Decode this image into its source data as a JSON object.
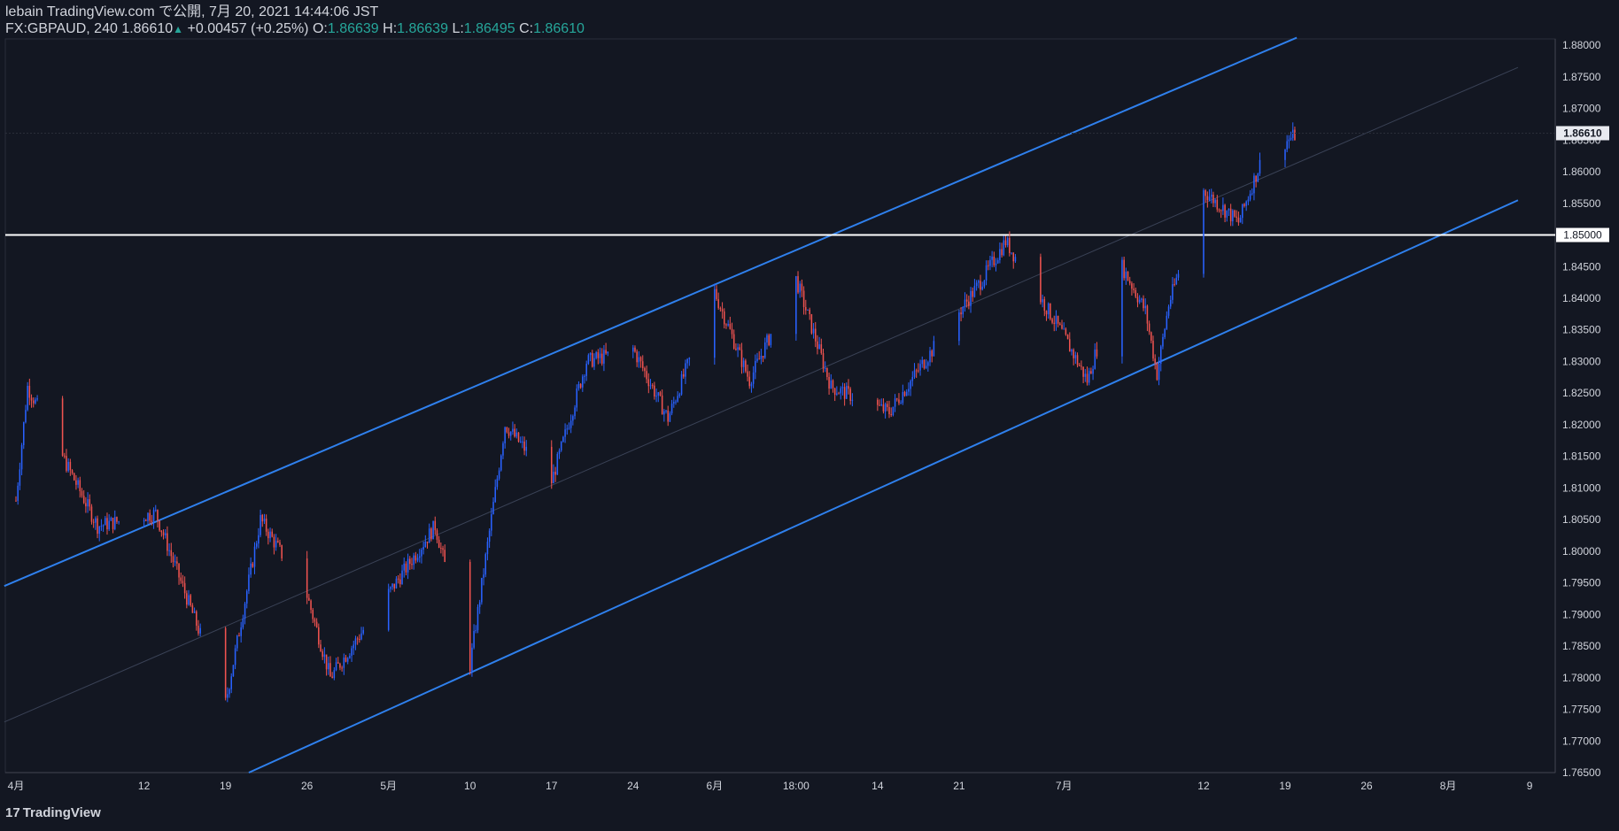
{
  "header": {
    "publish_line": "lebain TradingView.com で公開, 7月 20, 2021 14:44:06 JST",
    "symbol": "FX:GBPAUD, 240",
    "last": "1.86610",
    "change": "+0.00457 (+0.25%)",
    "o_label": "O:",
    "o_value": "1.86639",
    "h_label": "H:",
    "h_value": "1.86639",
    "l_label": "L:",
    "l_value": "1.86495",
    "c_label": "C:",
    "c_value": "1.86610"
  },
  "footer": {
    "logo_text": "TradingView"
  },
  "colors": {
    "background": "#131722",
    "up": "#2962ff",
    "down": "#ef5350",
    "channel": "#2f80ed",
    "level": "#ffffff",
    "axis_text": "#d1d4dc"
  },
  "chart_data": {
    "type": "candlestick",
    "symbol": "FX:GBPAUD",
    "interval": "240",
    "y_ticks": [
      "1.88000",
      "1.87500",
      "1.87000",
      "1.86500",
      "1.86000",
      "1.85500",
      "1.85000",
      "1.84500",
      "1.84000",
      "1.83500",
      "1.83000",
      "1.82500",
      "1.82000",
      "1.81500",
      "1.81000",
      "1.80500",
      "1.80000",
      "1.79500",
      "1.79000",
      "1.78500",
      "1.78000",
      "1.77500",
      "1.77000",
      "1.76500"
    ],
    "ylim": [
      1.765,
      1.881
    ],
    "x_ticks": [
      "4月",
      "12",
      "19",
      "26",
      "5月",
      "10",
      "17",
      "24",
      "6月",
      "18:00",
      "14",
      "21",
      "7月",
      "12",
      "19",
      "26",
      "8月",
      "9"
    ],
    "horizontal_level": 1.85,
    "horizontal_level_label": "1.85000",
    "last_price_label": "1.86610",
    "key_points": [
      {
        "date": "2021-04-01",
        "price": 1.808
      },
      {
        "date": "2021-04-02",
        "price": 1.826
      },
      {
        "date": "2021-04-08",
        "price": 1.804
      },
      {
        "date": "2021-04-13",
        "price": 1.806
      },
      {
        "date": "2021-04-19",
        "price": 1.776
      },
      {
        "date": "2021-04-22",
        "price": 1.805
      },
      {
        "date": "2021-04-26",
        "price": 1.793
      },
      {
        "date": "2021-04-28",
        "price": 1.78
      },
      {
        "date": "2021-05-04",
        "price": 1.796
      },
      {
        "date": "2021-05-07",
        "price": 1.804
      },
      {
        "date": "2021-05-10",
        "price": 1.782
      },
      {
        "date": "2021-05-13",
        "price": 1.82
      },
      {
        "date": "2021-05-17",
        "price": 1.811
      },
      {
        "date": "2021-05-20",
        "price": 1.83
      },
      {
        "date": "2021-05-24",
        "price": 1.832
      },
      {
        "date": "2021-05-27",
        "price": 1.821
      },
      {
        "date": "2021-05-31",
        "price": 1.841
      },
      {
        "date": "2021-06-03",
        "price": 1.827
      },
      {
        "date": "2021-06-07",
        "price": 1.843
      },
      {
        "date": "2021-06-10",
        "price": 1.826
      },
      {
        "date": "2021-06-15",
        "price": 1.822
      },
      {
        "date": "2021-06-18",
        "price": 1.83
      },
      {
        "date": "2021-06-23",
        "price": 1.843
      },
      {
        "date": "2021-06-25",
        "price": 1.849
      },
      {
        "date": "2021-06-30",
        "price": 1.834
      },
      {
        "date": "2021-07-02",
        "price": 1.827
      },
      {
        "date": "2021-07-05",
        "price": 1.845
      },
      {
        "date": "2021-07-07",
        "price": 1.838
      },
      {
        "date": "2021-07-08",
        "price": 1.828
      },
      {
        "date": "2021-07-09",
        "price": 1.839
      },
      {
        "date": "2021-07-12",
        "price": 1.857
      },
      {
        "date": "2021-07-15",
        "price": 1.852
      },
      {
        "date": "2021-07-17",
        "price": 1.862
      },
      {
        "date": "2021-07-20",
        "price": 1.866
      }
    ],
    "channel_lines": [
      {
        "name": "upper",
        "from": {
          "date": "2021-03-31",
          "price": 1.7945
        },
        "to": {
          "date": "2021-07-20",
          "price": 1.8812
        }
      },
      {
        "name": "lower",
        "from": {
          "date": "2021-04-21",
          "price": 1.765
        },
        "to": {
          "date": "2021-08-08",
          "price": 1.8555
        }
      },
      {
        "name": "middle",
        "from": {
          "date": "2021-03-31",
          "price": 1.773
        },
        "to": {
          "date": "2021-08-08",
          "price": 1.8765
        }
      }
    ]
  }
}
